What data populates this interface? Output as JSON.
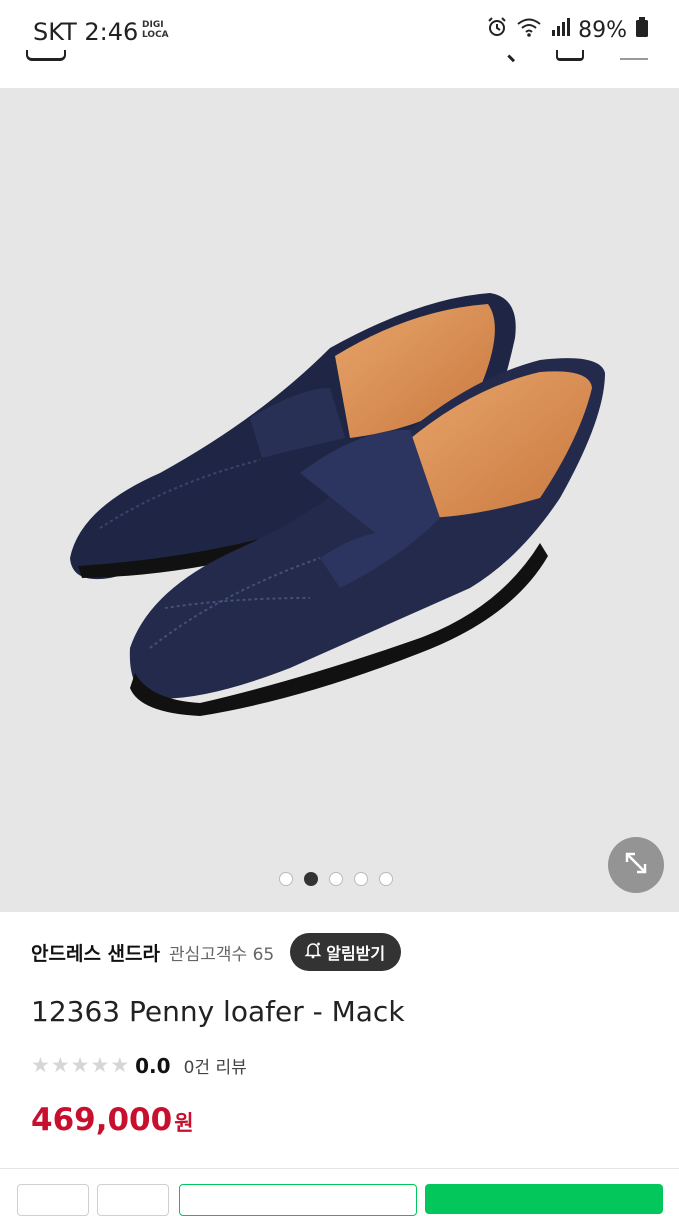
{
  "status_bar": {
    "carrier_time": "SKT 2:46",
    "digi_line1": "DIGI",
    "digi_line2": "LOCA",
    "battery": "89%"
  },
  "gallery": {
    "image_count": 5,
    "active_index": 1
  },
  "product": {
    "seller_name": "안드레스 샌드라",
    "watchers": "관심고객수 65",
    "alarm_label": "알림받기",
    "title": "12363 Penny loafer - Mack",
    "rating_value": "0.0",
    "review_count": "0건 리뷰",
    "price": "469,000",
    "currency": "원"
  },
  "colors": {
    "price": "#c8102e",
    "alarm_button": "#333333",
    "buy_green": "#03c75a"
  },
  "icons": {
    "expand": "expand-icon",
    "bell": "bell-icon",
    "star": "star-icon"
  }
}
